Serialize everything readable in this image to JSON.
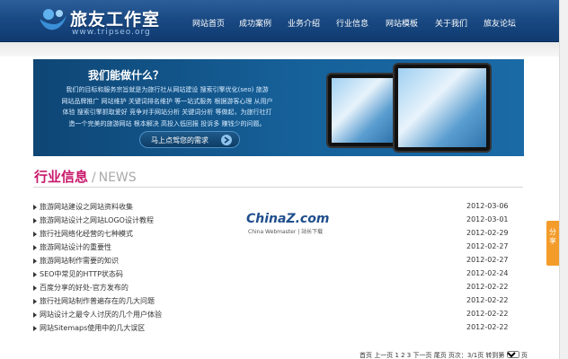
{
  "header": {
    "logo_name": "旅友工作室",
    "logo_url": "www.tripseo.org",
    "nav": [
      {
        "label": "网站首页"
      },
      {
        "label": "成功案例"
      },
      {
        "label": "业务介绍"
      },
      {
        "label": "行业信息"
      },
      {
        "label": "网站模板"
      },
      {
        "label": "关于我们"
      },
      {
        "label": "旅友论坛"
      }
    ]
  },
  "banner": {
    "title": "我们能做什么？",
    "desc_lines": [
      "我们的目标和服务宗旨就是为旅行社从网站建设 搜索引擎优化(seo) 旅游",
      "网站品牌推广 网站维护 关键词排名维护 等一站式服务 根据游客心理 从用户",
      "体验 搜索引擎抓取爱好 竞争对手网站分析 关键词分析 等做起，为旅行社打",
      "造一个完美的旅游网站 根本解决 高投入低回报 投诉多 赚钱少的问题。"
    ],
    "button_label": "马上点驾您的需求"
  },
  "section": {
    "title_cn": "行业信息",
    "slash": "/",
    "title_en": "NEWS"
  },
  "news": [
    {
      "title": "旅游网站建设之网站资料收集",
      "date": "2012-03-06"
    },
    {
      "title": "旅游网站设计之网站LOGO设计教程",
      "date": "2012-03-01"
    },
    {
      "title": "旅行社网络化经营的七种模式",
      "date": "2012-02-29"
    },
    {
      "title": "旅游网站设计的重要性",
      "date": "2012-02-27"
    },
    {
      "title": "旅游网站制作需要的知识",
      "date": "2012-02-27"
    },
    {
      "title": "SEO中常见的HTTP状态码",
      "date": "2012-02-24"
    },
    {
      "title": "百度分享的好处-官方发布的",
      "date": "2012-02-22"
    },
    {
      "title": "旅行社网站制作普遍存在的几大问题",
      "date": "2012-02-22"
    },
    {
      "title": "网站设计之最令人讨厌的几个用户体验",
      "date": "2012-02-22"
    },
    {
      "title": "网站Sitemaps使用中的几大误区",
      "date": "2012-02-22"
    }
  ],
  "watermark": {
    "logo": "ChinaZ.com",
    "sub": "China Webmaster | 站长下载"
  },
  "pager": {
    "text": "首页 上一页 1 2 3 下一页 尾页 页次：3/1页 转到第",
    "select_value": "1",
    "suffix": "页"
  },
  "share_tab": {
    "label": "分享"
  },
  "colors": {
    "header_bg": "#1a4a84",
    "accent": "#c8186b",
    "banner_bg": "#16619a",
    "share": "#f39c2a"
  }
}
